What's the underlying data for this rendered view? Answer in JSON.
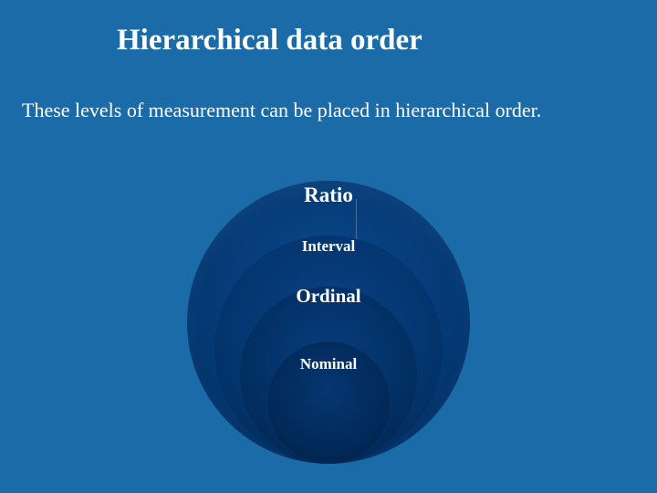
{
  "title": "Hierarchical data order",
  "subtitle": "These levels of measurement can be placed in hierarchical order.",
  "levels": {
    "ratio": "Ratio",
    "interval": "Interval",
    "ordinal": "Ordinal",
    "nominal": "Nominal"
  }
}
